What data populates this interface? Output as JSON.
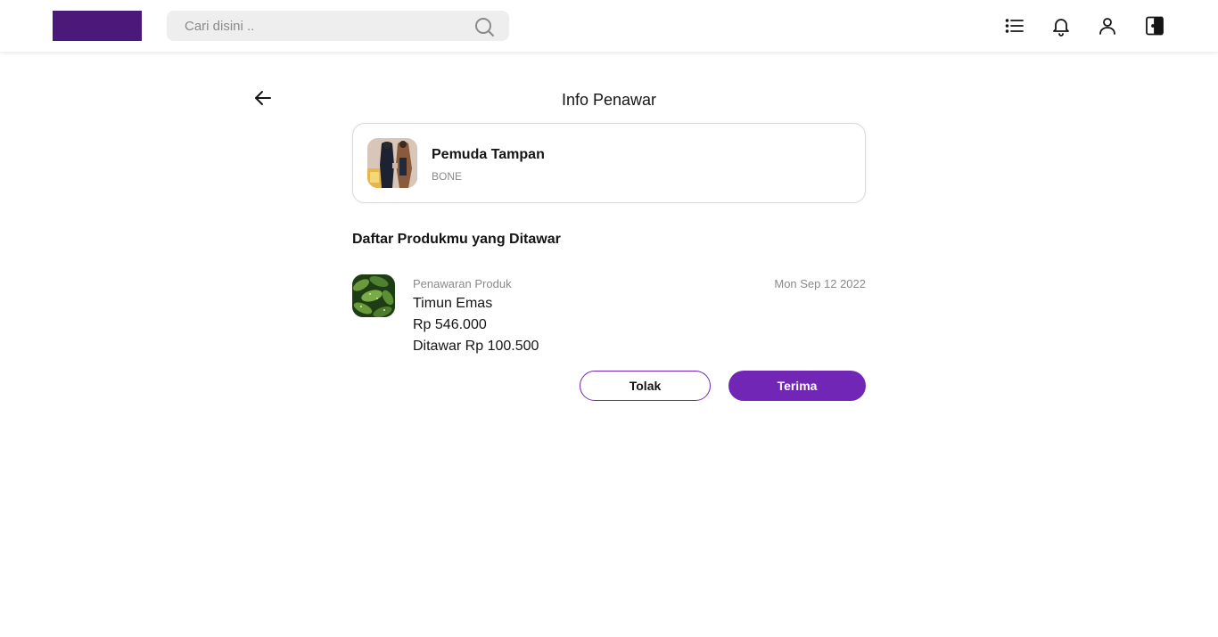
{
  "header": {
    "search_placeholder": "Cari disini ..",
    "icons": [
      "search-icon",
      "list-icon",
      "bell-icon",
      "user-icon",
      "logout-icon"
    ],
    "brand_color": "#4b1979"
  },
  "page": {
    "title": "Info Penawar",
    "back_icon": "arrow-left-icon"
  },
  "buyer": {
    "name": "Pemuda Tampan",
    "city": "BONE"
  },
  "offers_section": {
    "title": "Daftar Produkmu yang Ditawar"
  },
  "offer": {
    "label": "Penawaran Produk",
    "date": "Mon Sep 12 2022",
    "product_name": "Timun Emas",
    "price": "Rp 546.000",
    "offered_price": "Ditawar Rp 100.500",
    "reject_label": "Tolak",
    "accept_label": "Terima"
  },
  "colors": {
    "accent": "#7126b5",
    "muted_text": "#8a8a8a"
  }
}
